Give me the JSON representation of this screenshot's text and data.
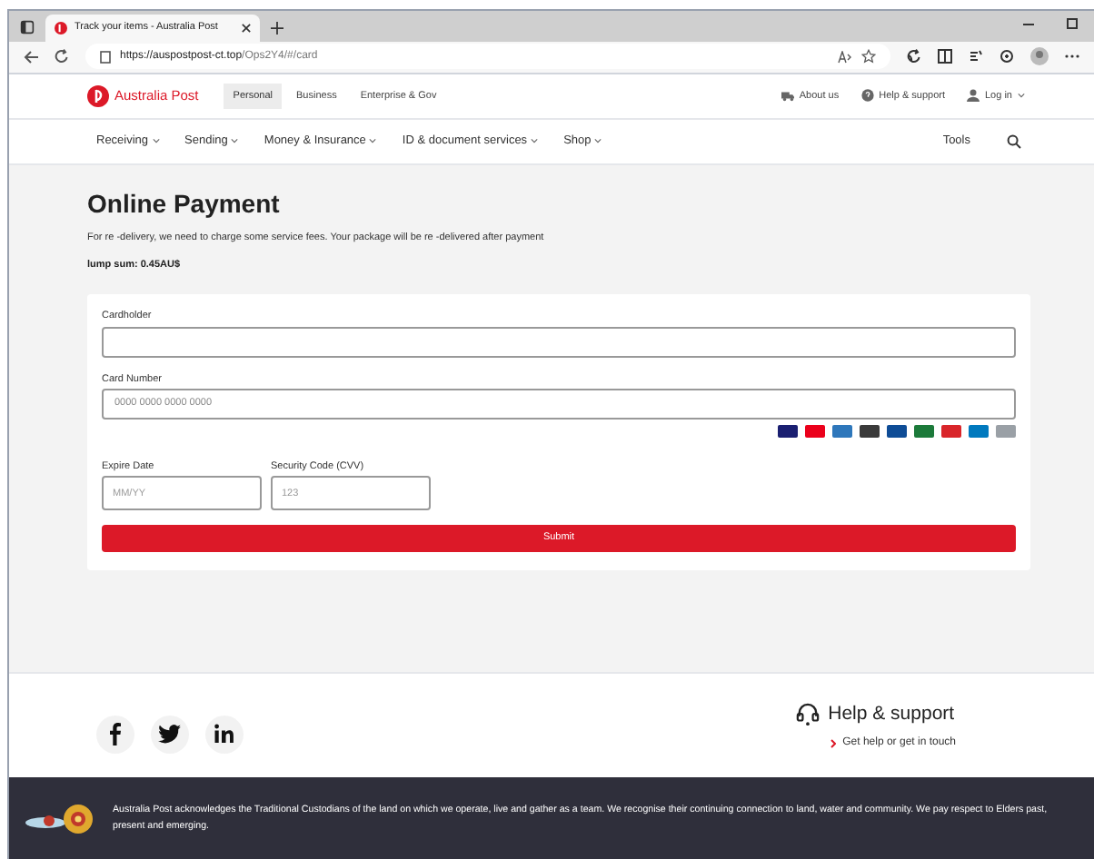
{
  "browser": {
    "tab_title": "Track your items - Australia Post",
    "url_host": "https://auspostpost-ct.top",
    "url_path": "/Ops2Y4/#/card"
  },
  "header": {
    "brand": "Australia Post",
    "segments": [
      {
        "label": "Personal",
        "selected": true
      },
      {
        "label": "Business",
        "selected": false
      },
      {
        "label": "Enterprise & Gov",
        "selected": false
      }
    ],
    "links": [
      {
        "kind": "truck",
        "label": "About us"
      },
      {
        "kind": "help",
        "label": "Help & support"
      },
      {
        "kind": "user",
        "label": "Log in"
      }
    ]
  },
  "nav": {
    "items": [
      "Receiving",
      "Sending",
      "Money & Insurance",
      "ID & document services",
      "Shop"
    ],
    "tools": "Tools"
  },
  "page": {
    "title": "Online Payment",
    "description": "For re -delivery, we need to charge some service fees. Your package will be re -delivered after payment",
    "amount": "lump sum: 0.45AU$"
  },
  "form": {
    "cardholder": {
      "label": "Cardholder"
    },
    "card_number": {
      "label": "Card Number",
      "placeholder": "0000 0000 0000 0000"
    },
    "expiry": {
      "label": "Expire Date",
      "placeholder": "MM/YY"
    },
    "cvv": {
      "label": "Security Code (CVV)",
      "placeholder": "123"
    },
    "card_logos": [
      {
        "color": "#1a1f71"
      },
      {
        "color": "#eb001b"
      },
      {
        "color": "#2e77bb"
      },
      {
        "color": "#3a3a3a"
      },
      {
        "color": "#0e4c96"
      },
      {
        "color": "#1c7a3a"
      },
      {
        "color": "#d9252a"
      },
      {
        "color": "#0079be"
      },
      {
        "color": "#9aa0a6"
      }
    ],
    "submit": "Submit"
  },
  "footer": {
    "help_title": "Help & support",
    "help_link": "Get help or get in touch",
    "acknowledgement": "Australia Post acknowledges the Traditional Custodians of the land on which we operate, live and gather as a team. We recognise their continuing connection to land, water and community. We pay respect to Elders past, present and emerging."
  }
}
